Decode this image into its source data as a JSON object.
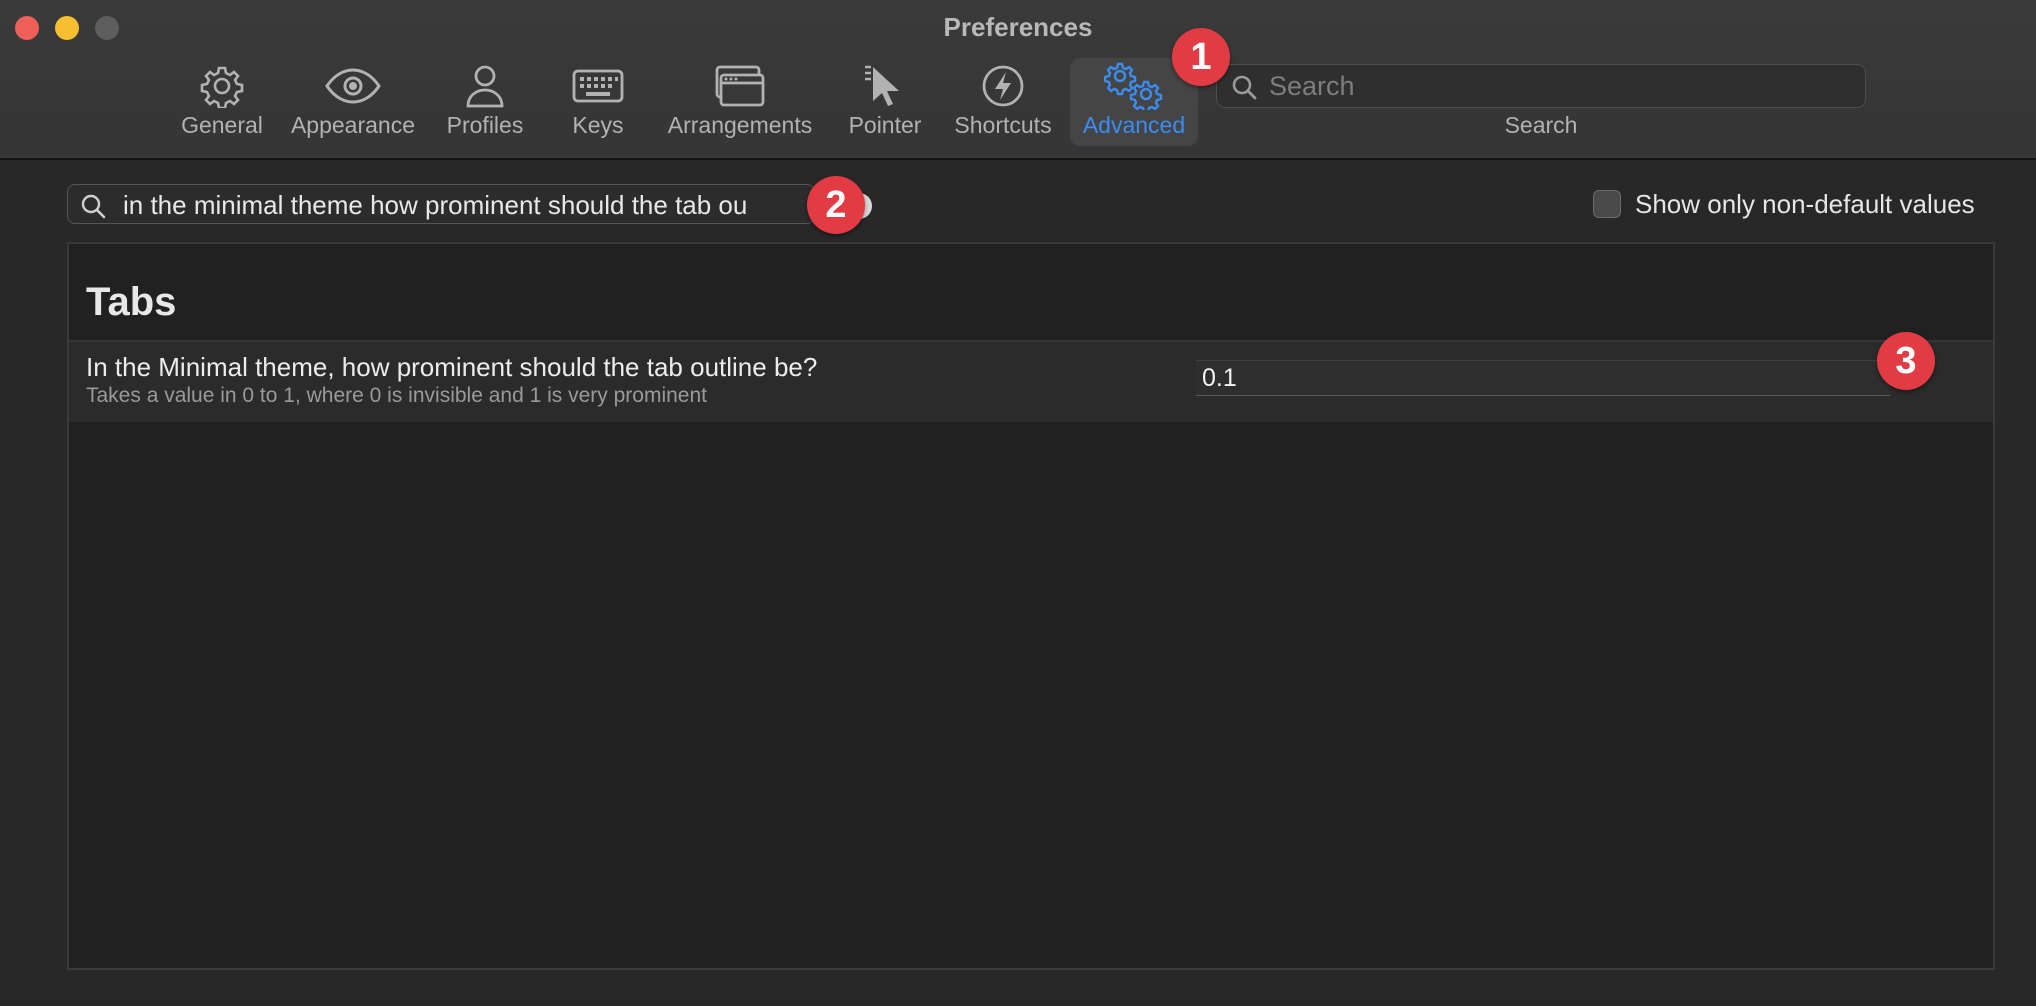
{
  "window": {
    "title": "Preferences"
  },
  "toolbar": {
    "items": [
      {
        "label": "General",
        "icon": "gear-icon"
      },
      {
        "label": "Appearance",
        "icon": "eye-icon"
      },
      {
        "label": "Profiles",
        "icon": "person-icon"
      },
      {
        "label": "Keys",
        "icon": "keyboard-icon"
      },
      {
        "label": "Arrangements",
        "icon": "window-stack-icon"
      },
      {
        "label": "Pointer",
        "icon": "pointer-icon"
      },
      {
        "label": "Shortcuts",
        "icon": "lightning-icon"
      },
      {
        "label": "Advanced",
        "icon": "gears-icon",
        "selected": true
      }
    ],
    "search": {
      "placeholder": "Search",
      "caption": "Search"
    }
  },
  "filter": {
    "value": "in the minimal theme how prominent should the tab ou",
    "show_non_default_label": "Show only non-default values",
    "show_non_default_checked": false
  },
  "section": {
    "title": "Tabs",
    "setting": {
      "question": "In the Minimal theme, how prominent should the tab outline be?",
      "description": "Takes a value in 0 to 1, where 0 is invisible and 1 is very prominent",
      "value": "0.1"
    }
  },
  "annotations": [
    "1",
    "2",
    "3"
  ],
  "colors": {
    "accent": "#3b8cf3",
    "badge": "#e23b44"
  }
}
